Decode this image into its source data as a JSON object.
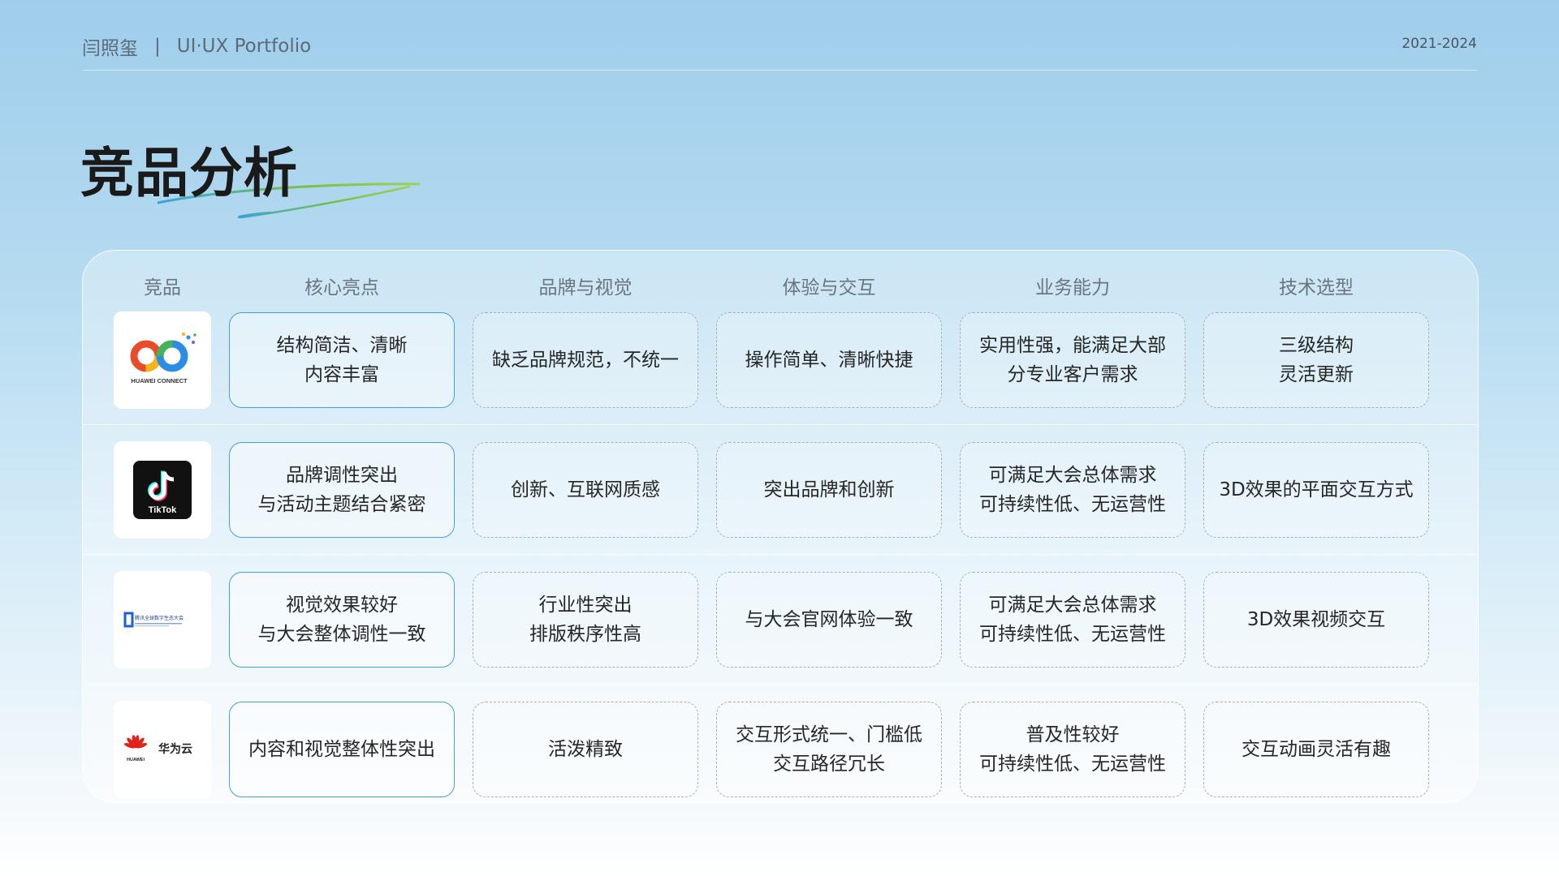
{
  "header": {
    "author": "闫照玺",
    "separator": "|",
    "subtitle": "UI·UX Portfolio",
    "years": "2021-2024"
  },
  "page_title": "竞品分析",
  "table": {
    "headers": [
      "竞品",
      "核心亮点",
      "品牌与视觉",
      "体验与交互",
      "业务能力",
      "技术选型"
    ],
    "rows": [
      {
        "logo_icon": "huawei-connect-logo",
        "logo_text": "HUAWEI CONNECT",
        "cells": [
          "结构简洁、清晰\n内容丰富",
          "缺乏品牌规范，不统一",
          "操作简单、清晰快捷",
          "实用性强，能满足大部\n分专业客户需求",
          "三级结构\n灵活更新"
        ]
      },
      {
        "logo_icon": "tiktok-logo",
        "logo_text": "TikTok",
        "cells": [
          "品牌调性突出\n与活动主题结合紧密",
          "创新、互联网质感",
          "突出品牌和创新",
          "可满足大会总体需求\n可持续性低、无运营性",
          "3D效果的平面交互方式"
        ]
      },
      {
        "logo_icon": "tencent-global-digital-ecosystem-logo",
        "logo_text": "腾讯全球数字生态大会",
        "cells": [
          "视觉效果较好\n与大会整体调性一致",
          "行业性突出\n排版秩序性高",
          "与大会官网体验一致",
          "可满足大会总体需求\n可持续性低、无运营性",
          "3D效果视频交互"
        ]
      },
      {
        "logo_icon": "huawei-cloud-logo",
        "logo_text": "华为云",
        "logo_subtext": "HUAWEI",
        "cells": [
          "内容和视觉整体性突出",
          "活泼精致",
          "交互形式统一、门槛低\n交互路径冗长",
          "普及性较好\n可持续性低、无运营性",
          "交互动画灵活有趣"
        ]
      }
    ]
  },
  "colors": {
    "highlight_border": "#4a9ed8",
    "dashed_border": "#a7b0b8",
    "swoosh_green": "#7cc243",
    "swoosh_blue": "#3aa3d9"
  }
}
